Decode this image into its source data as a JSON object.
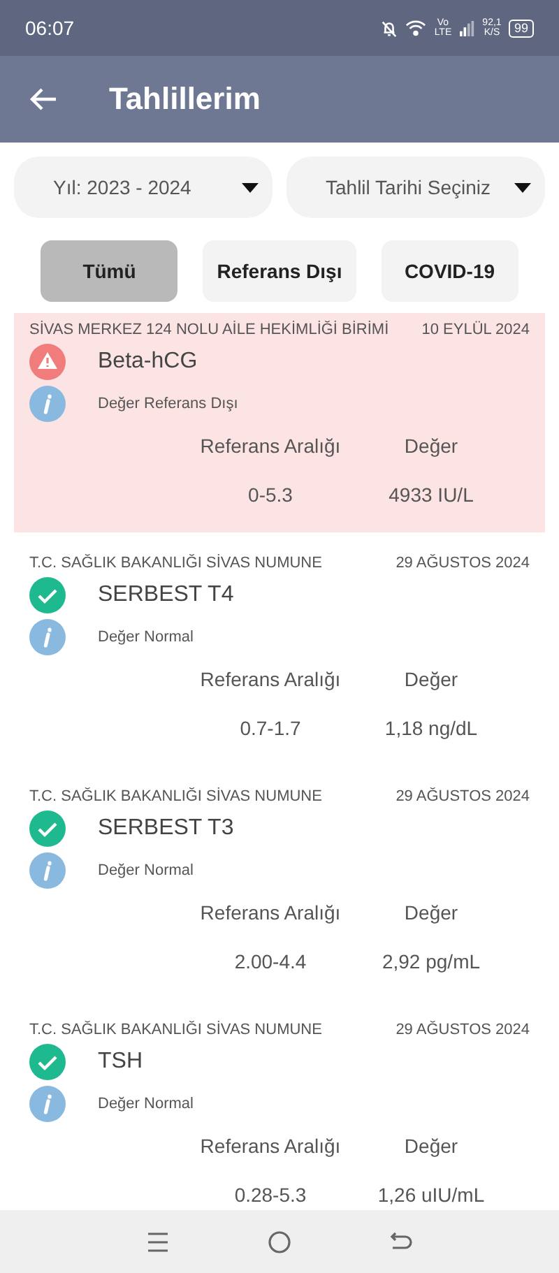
{
  "status_bar": {
    "time": "06:07",
    "network": "Vo LTE",
    "speed": "92,1 K/S",
    "battery": "99"
  },
  "app_bar": {
    "title": "Tahlillerim"
  },
  "dropdowns": [
    {
      "label": "Yıl: 2023 - 2024"
    },
    {
      "label": "Tahlil Tarihi Seçiniz"
    }
  ],
  "filters": [
    {
      "label": "Tümü",
      "selected": true
    },
    {
      "label": "Referans Dışı",
      "selected": false
    },
    {
      "label": "COVID-19",
      "selected": false
    }
  ],
  "results": [
    {
      "source": "SİVAS MERKEZ 124 NOLU AİLE HEKİMLİĞİ BİRİMİ",
      "date": "10 EYLÜL 2024",
      "name": "Beta-hCG",
      "status": "Değer Referans Dışı",
      "kind": "warning",
      "range_label": "Referans Aralığı",
      "value_label": "Değer",
      "range": "0-5.3",
      "value": "4933 IU/L"
    },
    {
      "source": "T.C. SAĞLIK BAKANLIĞI SİVAS NUMUNE",
      "date": "29 AĞUSTOS 2024",
      "name": "SERBEST T4",
      "status": "Değer Normal",
      "kind": "normal",
      "range_label": "Referans Aralığı",
      "value_label": "Değer",
      "range": "0.7-1.7",
      "value": "1,18 ng/dL"
    },
    {
      "source": "T.C. SAĞLIK BAKANLIĞI SİVAS NUMUNE",
      "date": "29 AĞUSTOS 2024",
      "name": "SERBEST T3",
      "status": "Değer Normal",
      "kind": "normal",
      "range_label": "Referans Aralığı",
      "value_label": "Değer",
      "range": "2.00-4.4",
      "value": "2,92 pg/mL"
    },
    {
      "source": "T.C. SAĞLIK BAKANLIĞI SİVAS NUMUNE",
      "date": "29 AĞUSTOS 2024",
      "name": "TSH",
      "status": "Değer Normal",
      "kind": "normal",
      "range_label": "Referans Aralığı",
      "value_label": "Değer",
      "range": "0.28-5.3",
      "value": "1,26 uIU/mL"
    }
  ]
}
